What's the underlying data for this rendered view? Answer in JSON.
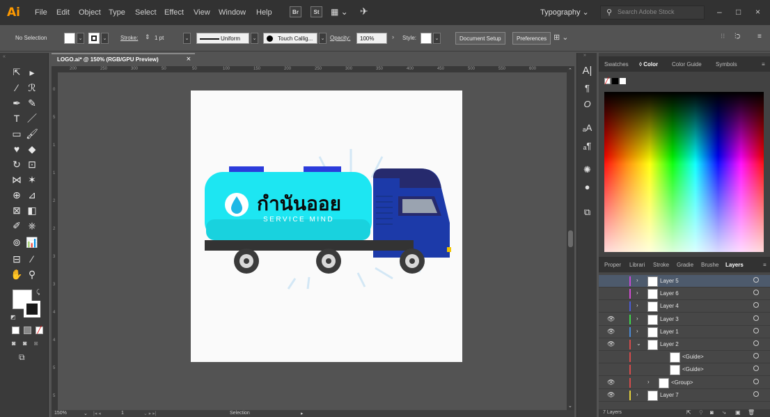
{
  "app": {
    "logo": "Ai",
    "workspace": "Typography",
    "search_placeholder": "Search Adobe Stock"
  },
  "menu": {
    "items": [
      "File",
      "Edit",
      "Object",
      "Type",
      "Select",
      "Effect",
      "View",
      "Window",
      "Help"
    ],
    "bridge": "Br",
    "stock": "St"
  },
  "window_controls": {
    "minimize": "–",
    "maximize": "□",
    "close": "×"
  },
  "control_bar": {
    "selection": "No Selection",
    "stroke_label": "Stroke:",
    "stroke_value": "1 pt",
    "profile": "Uniform",
    "brush": "Touch Callig...",
    "opacity_label": "Opacity:",
    "opacity_value": "100%",
    "style_label": "Style:",
    "document_setup": "Document Setup",
    "preferences": "Preferences"
  },
  "document": {
    "tab_title": "LOGO.ai* @ 150% (RGB/GPU Preview)",
    "close": "×",
    "ruler_top": [
      "200",
      "250",
      "300",
      "50",
      "50",
      "100",
      "150",
      "200",
      "250",
      "300",
      "350",
      "400",
      "450",
      "500",
      "550",
      "600"
    ],
    "ruler_left": [
      "0",
      "5",
      "1",
      "1",
      "2",
      "2",
      "3",
      "3",
      "4",
      "4",
      "5",
      "5"
    ]
  },
  "artwork": {
    "logo_text": "กำนันออย",
    "tagline": "SERVICE MIND",
    "colors": {
      "tank": "#1de6f2",
      "cab": "#1c3aa9",
      "cab_dark": "#262a6d",
      "cap": "#2b3bdb"
    }
  },
  "status": {
    "zoom": "150%",
    "page": "1",
    "tool": "Selection"
  },
  "panels": {
    "top_tabs": [
      "Swatches",
      "Color",
      "Color Guide",
      "Symbols"
    ],
    "top_active": "Color",
    "bottom_tabs": [
      "Proper",
      "Librari",
      "Stroke",
      "Gradie",
      "Brushe",
      "Layers"
    ],
    "bottom_active": "Layers",
    "layers": [
      {
        "name": "Layer 5",
        "color": "#c64bd6",
        "visible": false,
        "indent": 0,
        "arrow": "›"
      },
      {
        "name": "Layer 6",
        "color": "#d24bd6",
        "visible": false,
        "indent": 0,
        "arrow": "›"
      },
      {
        "name": "Layer 4",
        "color": "#4b5cd6",
        "visible": false,
        "indent": 0,
        "arrow": "›"
      },
      {
        "name": "Layer 3",
        "color": "#3fd64b",
        "visible": true,
        "indent": 0,
        "arrow": "›"
      },
      {
        "name": "Layer 1",
        "color": "#4b8ad6",
        "visible": true,
        "indent": 0,
        "arrow": "›"
      },
      {
        "name": "Layer 2",
        "color": "#d64b4b",
        "visible": true,
        "indent": 0,
        "arrow": "⌄"
      },
      {
        "name": "<Guide>",
        "color": "#d64b4b",
        "visible": false,
        "indent": 2,
        "arrow": ""
      },
      {
        "name": "<Guide>",
        "color": "#d64b4b",
        "visible": false,
        "indent": 2,
        "arrow": ""
      },
      {
        "name": "<Group>",
        "color": "#d64b4b",
        "visible": true,
        "indent": 1,
        "arrow": "›"
      },
      {
        "name": "Layer 7",
        "color": "#e6d23c",
        "visible": true,
        "indent": 0,
        "arrow": "›"
      }
    ],
    "layers_count": "7 Layers"
  }
}
